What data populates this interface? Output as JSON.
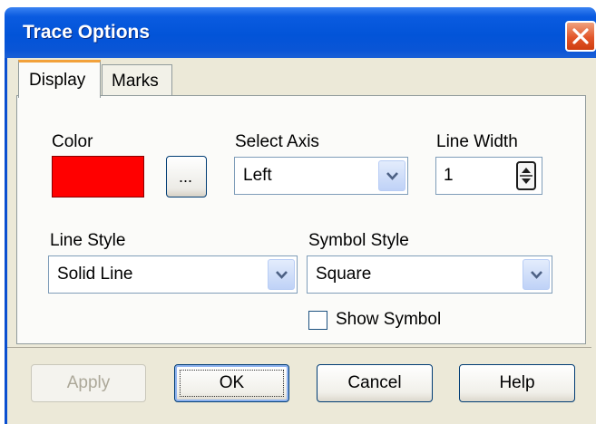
{
  "window": {
    "title": "Trace Options"
  },
  "tabs": [
    {
      "label": "Display",
      "active": true
    },
    {
      "label": "Marks",
      "active": false
    }
  ],
  "display": {
    "color_label": "Color",
    "color_value": "#ff0000",
    "browse_label": "...",
    "axis_label": "Select Axis",
    "axis_value": "Left",
    "line_width_label": "Line Width",
    "line_width_value": "1",
    "line_style_label": "Line Style",
    "line_style_value": "Solid Line",
    "symbol_style_label": "Symbol Style",
    "symbol_style_value": "Square",
    "show_symbol_label": "Show Symbol",
    "show_symbol_checked": false
  },
  "buttons": {
    "apply": "Apply",
    "ok": "OK",
    "cancel": "Cancel",
    "help": "Help"
  },
  "icons": {
    "close": "close-icon",
    "dropdown": "chevron-down-icon",
    "spinner": "spinner-icon"
  }
}
